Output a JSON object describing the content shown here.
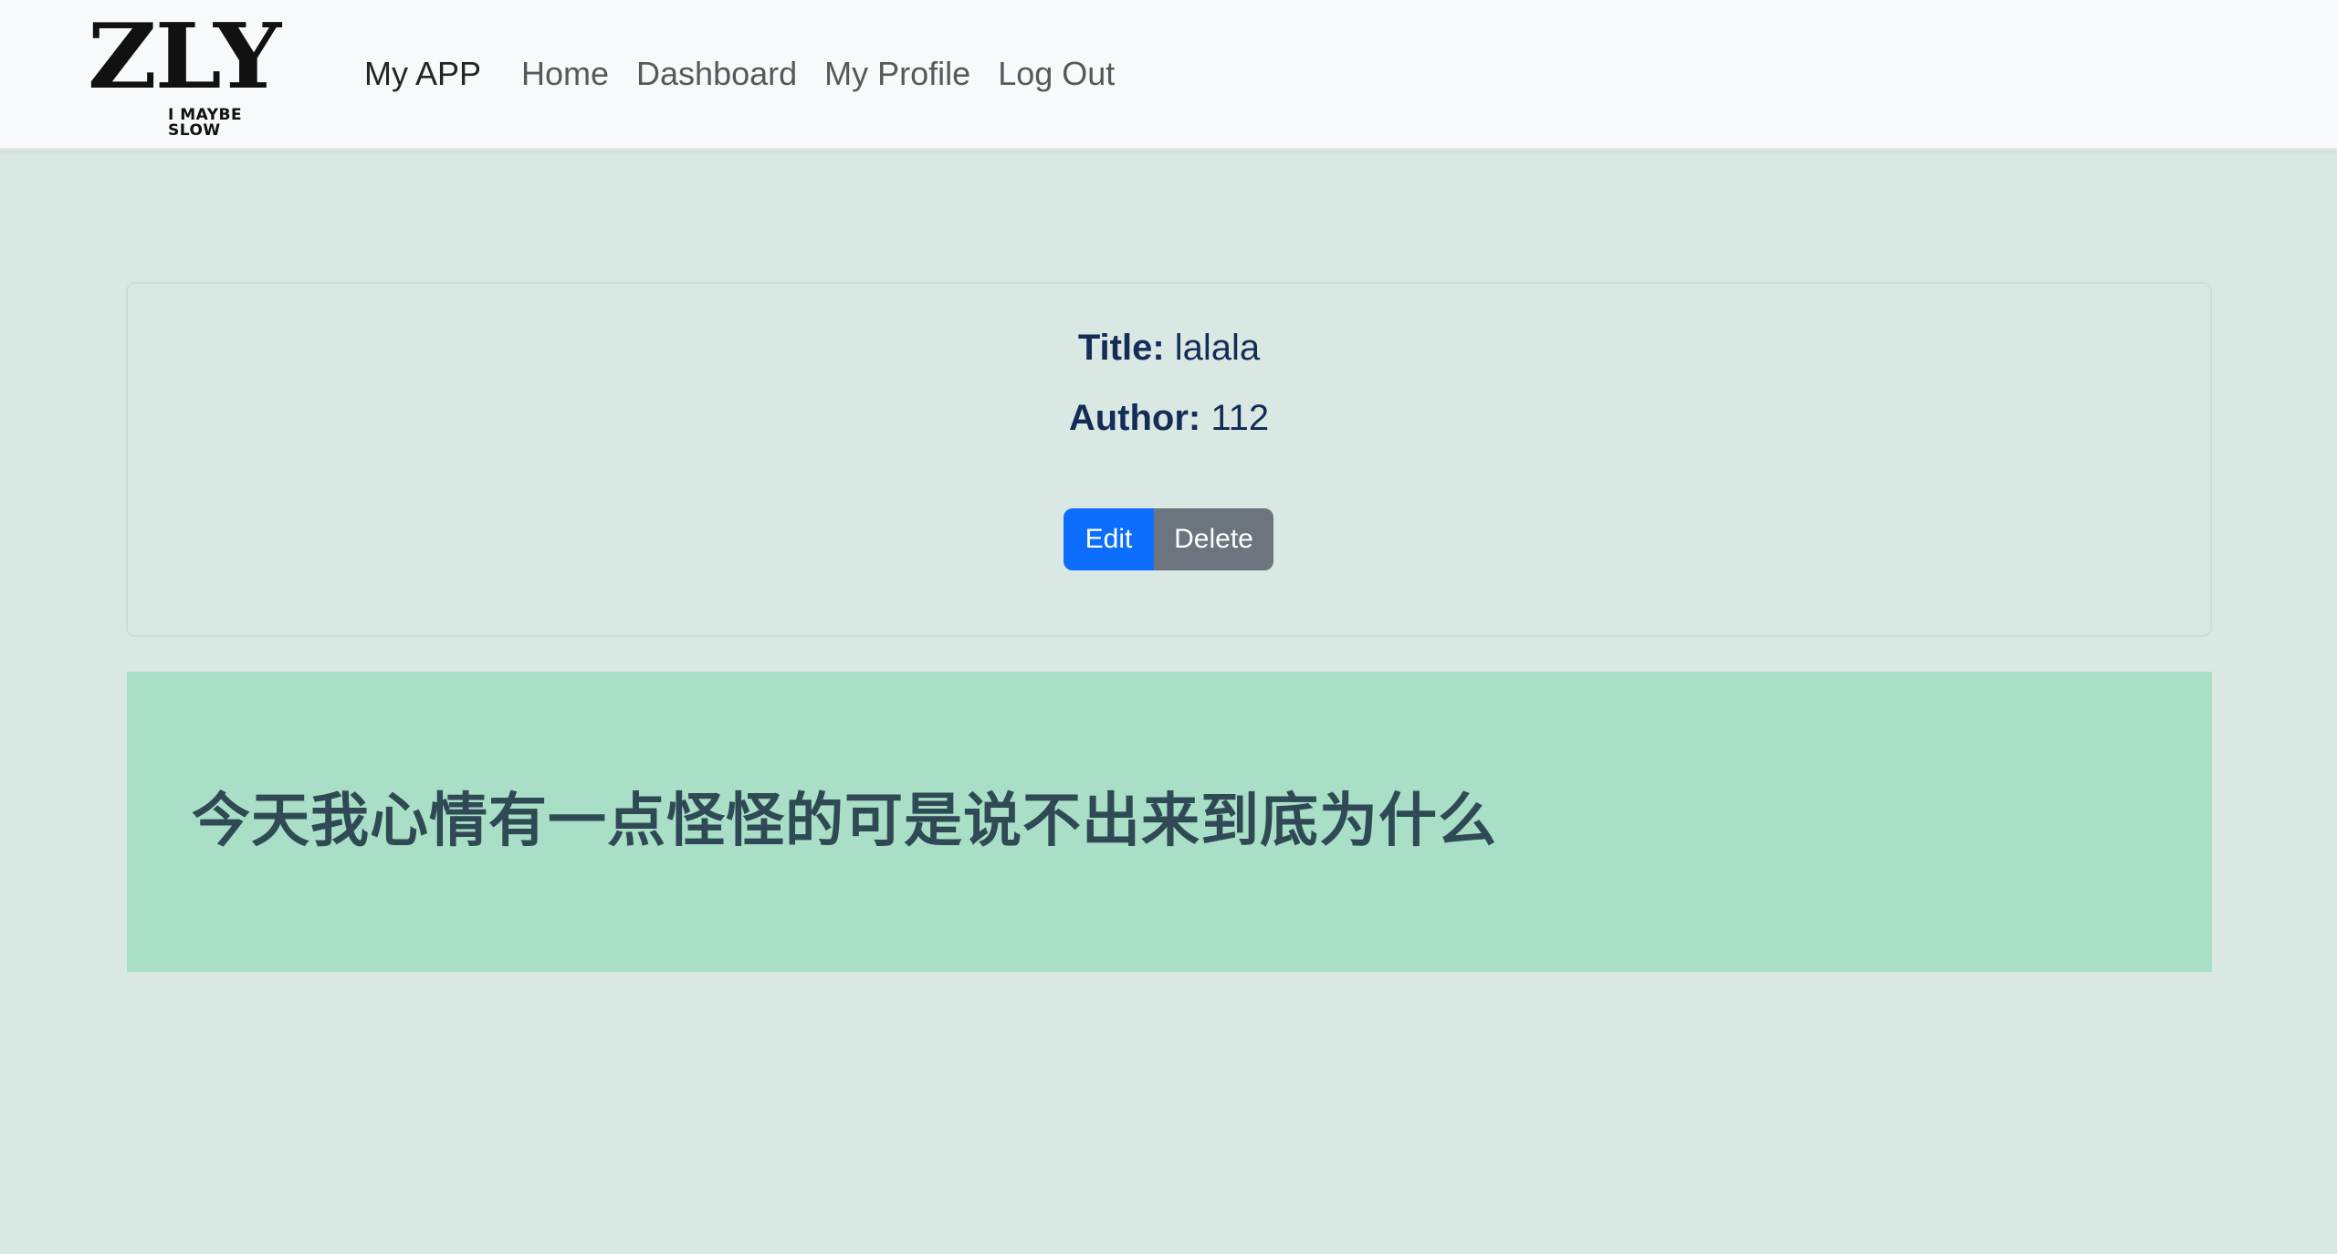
{
  "brand": {
    "logo_text": "ZLY",
    "logo_tagline": "I MAYBE SLOW"
  },
  "navbar": {
    "app_name": "My APP",
    "links": [
      {
        "label": "Home"
      },
      {
        "label": "Dashboard"
      },
      {
        "label": "My Profile"
      },
      {
        "label": "Log Out"
      }
    ]
  },
  "post": {
    "title_label": "Title:",
    "title_value": "lalala",
    "author_label": "Author:",
    "author_value": "112",
    "edit_label": "Edit",
    "delete_label": "Delete",
    "content": "今天我心情有一点怪怪的可是说不出来到底为什么"
  },
  "colors": {
    "navbar_bg": "#f8f9fa",
    "page_bg": "#dae8e4",
    "content_bg": "#a9dfc7",
    "edit_button": "#0d6efd",
    "delete_button": "#6c757d",
    "heading_text": "#132d57"
  }
}
